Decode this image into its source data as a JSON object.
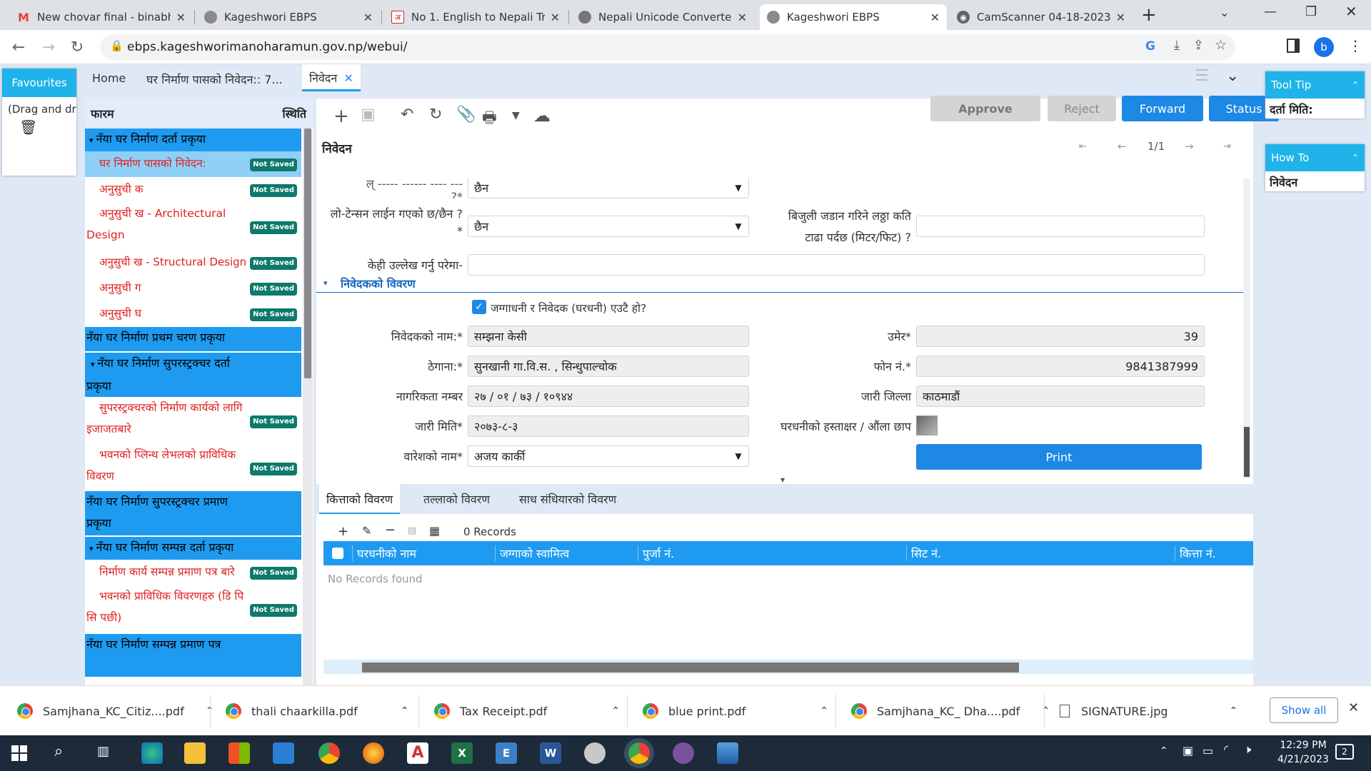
{
  "browser": {
    "tabs": [
      {
        "title": "New chovar final - binabha",
        "icon": "gmail-icon",
        "active": false
      },
      {
        "title": "Kageshwori EBPS",
        "icon": "site-icon",
        "active": false
      },
      {
        "title": "No 1. English to Nepali Tran",
        "icon": "devanagari-icon",
        "active": false
      },
      {
        "title": "Nepali Unicode Converter |",
        "icon": "converter-icon",
        "active": false
      },
      {
        "title": "Kageshwori EBPS",
        "icon": "site-icon",
        "active": true
      },
      {
        "title": "CamScanner 04-18-2023 1",
        "icon": "globe-icon",
        "active": false
      }
    ],
    "url": "ebps.kageshworimanoharamun.gov.np/webui/",
    "profile": "b"
  },
  "favourites": {
    "title": "Favourites",
    "hint": "(Drag and drc"
  },
  "main_tabs": [
    {
      "label": "Home"
    },
    {
      "label": "घर निर्माण पासको निवेदन:: 7..."
    },
    {
      "label": "निवेदन",
      "active": true
    }
  ],
  "tree": {
    "col_form": "फारम",
    "col_status": "स्थिति",
    "nodes": [
      {
        "kind": "group",
        "label": "नँया घर निर्माण दर्ता प्रकृया",
        "expanded": true
      },
      {
        "kind": "item",
        "label": "घर निर्माण पासको निवेदन:",
        "badge": "Not Saved",
        "selected": true
      },
      {
        "kind": "item",
        "label": "अनुसुची क",
        "badge": "Not Saved"
      },
      {
        "kind": "item",
        "label": "अनुसुची ख - Architectural Design",
        "badge": "Not Saved"
      },
      {
        "kind": "item",
        "label": "अनुसुची ख - Structural Design",
        "badge": "Not Saved"
      },
      {
        "kind": "item",
        "label": "अनुसुची ग",
        "badge": "Not Saved"
      },
      {
        "kind": "item",
        "label": "अनुसुची घ",
        "badge": "Not Saved"
      },
      {
        "kind": "group",
        "label": "नँया घर निर्माण प्रथम चरण प्रकृया"
      },
      {
        "kind": "group",
        "label": "नँया घर निर्माण सुपरस्ट्रक्चर दर्ता प्रकृया",
        "expanded": true
      },
      {
        "kind": "item",
        "label": "सुपरस्ट्रक्चरको निर्माण कार्यको लागि इजाजतबारे",
        "badge": "Not Saved"
      },
      {
        "kind": "item",
        "label": "भवनको प्लिन्थ लेभलको प्राविधिक विवरण",
        "badge": "Not Saved"
      },
      {
        "kind": "group",
        "label": "नँया घर निर्माण सुपरस्ट्रक्चर प्रमाण प्रकृया"
      },
      {
        "kind": "group",
        "label": "नँया घर निर्माण सम्पन्न दर्ता प्रकृया",
        "expanded": true
      },
      {
        "kind": "item",
        "label": "निर्माण कार्य सम्पन्न प्रमाण पत्र बारे",
        "badge": "Not Saved"
      },
      {
        "kind": "item",
        "label": "भवनको प्राविधिक विवरणहरु (डि पि सि पछी)",
        "badge": "Not Saved"
      },
      {
        "kind": "group",
        "label": "नँया घर निर्माण सम्पन्न प्रमाण पत्र"
      }
    ]
  },
  "toolbar": {
    "approve": "Approve",
    "reject": "Reject",
    "forward": "Forward",
    "status": "Status",
    "title": "निवेदन",
    "pager": "1/1"
  },
  "form": {
    "row0_label": "?*",
    "row0_value": "छैन",
    "lowtension_label": "लो-टेन्सन लाईन गएको छ/छैन ?",
    "lowtension_star": "*",
    "lowtension_value": "छैन",
    "pole_label_1": "बिजुली जडान गरिने लठ्ठा कति",
    "pole_label_2": "टाढा पर्दछ (मिटर/फिट) ?",
    "pole_value": "",
    "remarks_label": "केही उल्लेख गर्नु परेमा-",
    "remarks_value": "",
    "section_title": "निवेदकको विवरण",
    "same_owner_label": "जग्गाधनी र निवेदक (घरधनी) एउटै हो?",
    "name_label": "निवेदकको नाम:*",
    "name_value": "सम्झना केसी",
    "age_label": "उमेर*",
    "age_value": "39",
    "address_label": "ठेगाना:*",
    "address_value": "सुनखानी गा.वि.स. , सिन्धुपाल्चोक",
    "phone_label": "फोन नं.*",
    "phone_value": "9841387999",
    "citizenship_label": "नागरिकता नम्बर",
    "citizenship_value": "२७ / ०१ / ७३ / १०९४४",
    "district_label": "जारी जिल्ला",
    "district_value": "काठमाडौं",
    "issue_date_label": "जारी मिति*",
    "issue_date_value": "२०७३-८-३",
    "signature_label": "घरधनीको हस्ताक्षर / औंला छाप",
    "heir_label": "वारेशको नाम*",
    "heir_value": "अजय कार्की",
    "print_label": "Print"
  },
  "grid": {
    "tabs": [
      "कित्ताको विवरण",
      "तल्लाको विवरण",
      "साध संधियारको विवरण"
    ],
    "records": "0 Records",
    "columns": [
      "घरधनीको नाम",
      "जग्गाको स्वामित्व",
      "पुर्जा नं.",
      "सिट नं.",
      "कित्ता नं."
    ],
    "empty": "No Records found"
  },
  "right": {
    "tooltip_title": "Tool Tip",
    "tooltip_text": "दर्ता मिति:",
    "howto_title": "How To",
    "howto_text": "निवेदन"
  },
  "downloads": {
    "items": [
      "Samjhana_KC_Citiz....pdf",
      "thali chaarkilla.pdf",
      "Tax Receipt.pdf",
      "blue print.pdf",
      "Samjhana_KC_ Dha....pdf",
      "SIGNATURE.jpg"
    ],
    "show_all": "Show all"
  },
  "taskbar": {
    "time": "12:29 PM",
    "date": "4/21/2023",
    "notifications": "2"
  }
}
